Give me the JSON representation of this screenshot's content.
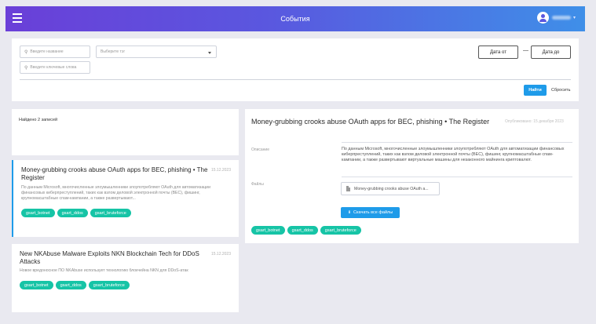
{
  "header": {
    "title": "События"
  },
  "filters": {
    "name_placeholder": "Введите название",
    "tag_placeholder": "Выберите тэг",
    "keywords_placeholder": "Введите ключевые слова",
    "date_from": "Дата от",
    "date_to": "Дата до",
    "find_label": "Найти",
    "reset_label": "Сбросить"
  },
  "results": {
    "count_text": "Найдено 2 записей",
    "items": [
      {
        "title": "Money-grubbing crooks abuse OAuth apps for BEC, phishing • The Register",
        "date": "15.12.2023",
        "description": "По данным Microsoft, многочисленные злоумышленники злоупотребляют OAuth для автоматизации финансовых киберпреступлений, таких как взлом деловой электронной почты (BEC), фишинг, крупномасштабные спам-кампании, а также развертывают...",
        "tags": [
          "gsart_botnet",
          "gsart_ddos",
          "gsart_bruteforce"
        ]
      },
      {
        "title": "New NKAbuse Malware Exploits NKN Blockchain Tech for DDoS Attacks",
        "date": "15.12.2023",
        "description": "Новое вредоносное ПО NKAbuse использует технологию блокчейна NKN для DDoS-атак",
        "tags": [
          "gsart_botnet",
          "gsart_ddos",
          "gsart_bruteforce"
        ]
      }
    ]
  },
  "detail": {
    "title": "Money-grubbing crooks abuse OAuth apps for BEC, phishing • The Register",
    "published": "Опубликовано: 15 декабря 2023",
    "description_label": "Описание",
    "description": "По данным Microsoft, многочисленные злоумышленники злоупотребляют OAuth для автоматизации финансовых киберпреступлений, таких как взлом деловой электронной почты (BEC), фишинг, крупномасштабные спам-кампании, а также развертывают виртуальные машины для незаконного майнинга криптовалют.",
    "files_label": "Файлы",
    "file_name": "Money-grubbing crooks abuse OAuth a...",
    "download_all_label": "Скачать все файлы",
    "tags": [
      "gsart_botnet",
      "gsart_ddos",
      "gsart_bruteforce"
    ]
  },
  "icons": {
    "menu": "menu-icon",
    "search": "search-icon",
    "avatar": "user-avatar-icon",
    "file": "file-icon",
    "download": "download-icon"
  },
  "colors": {
    "accent": "#1e9be9",
    "tag": "#16c4a6",
    "header_start": "#6a3fd8",
    "header_end": "#3f8fe8"
  }
}
